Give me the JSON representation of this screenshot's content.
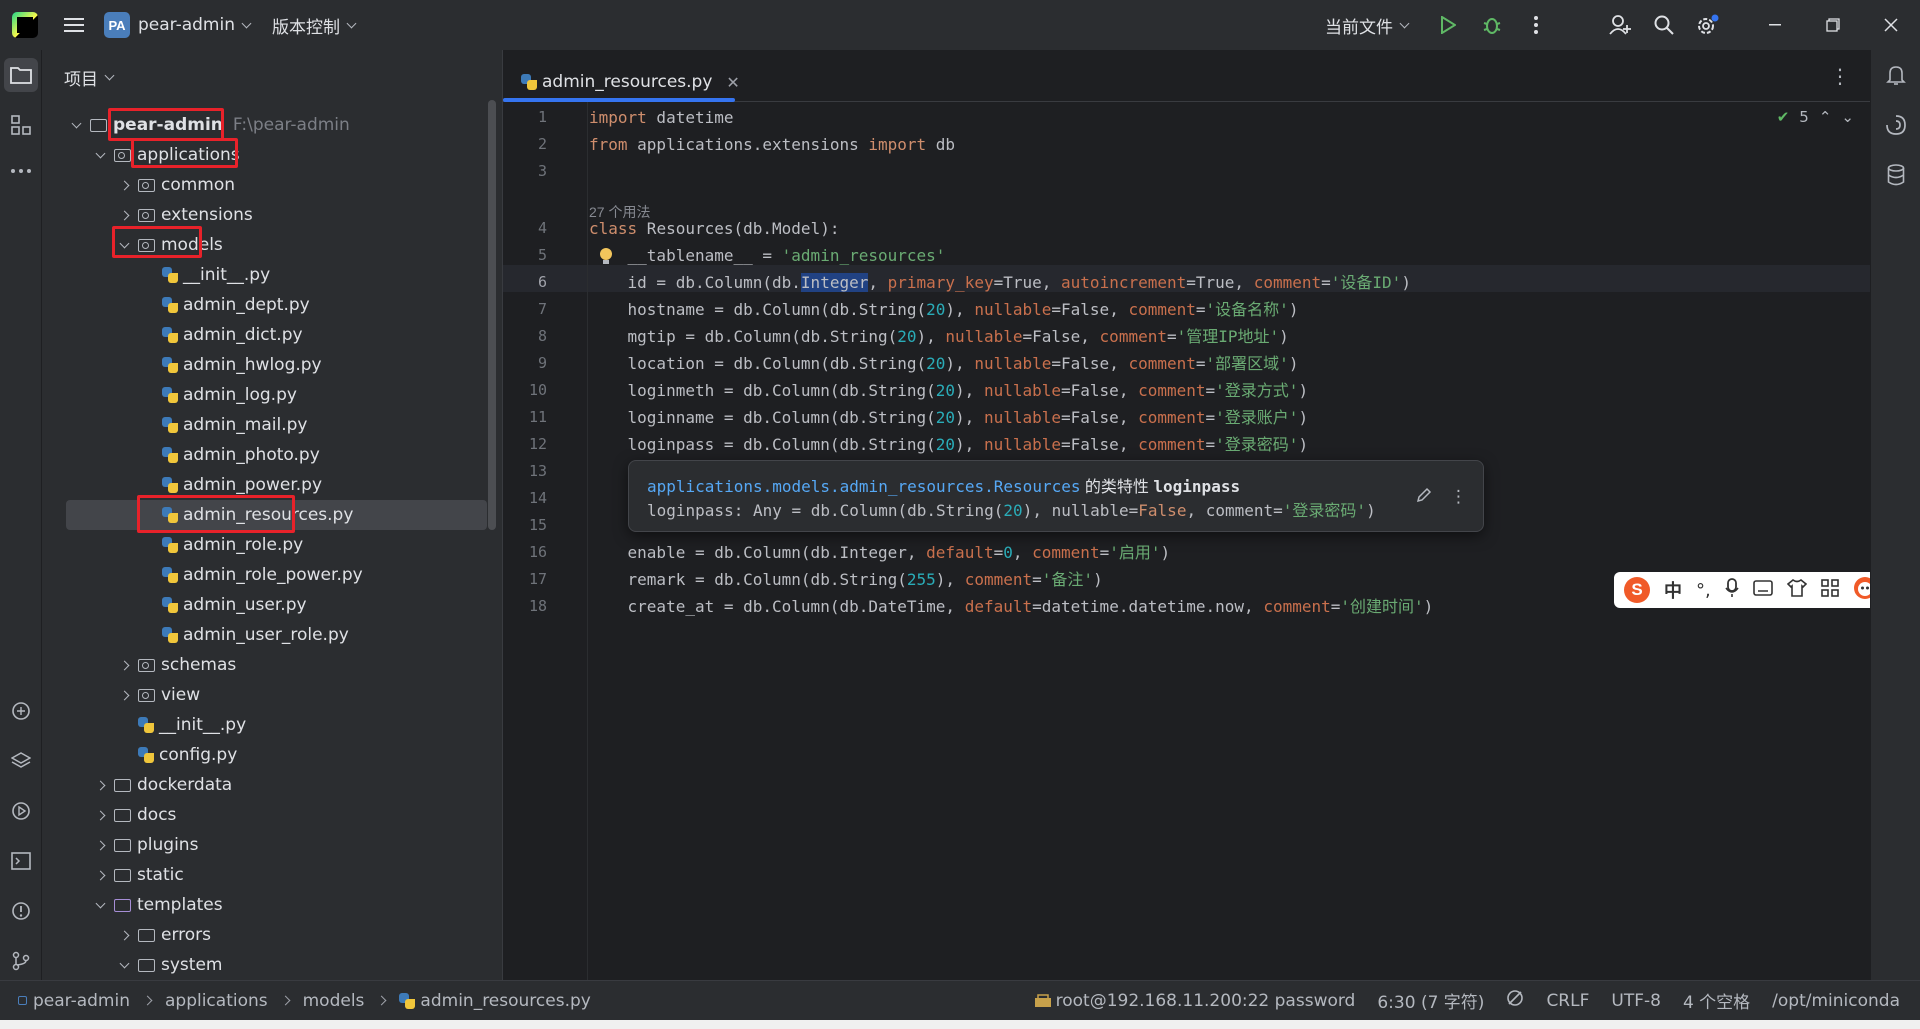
{
  "titlebar": {
    "project_badge": "PA",
    "project_name": "pear-admin",
    "vcs": "版本控制",
    "run_config": "当前文件"
  },
  "project_panel": {
    "title": "项目",
    "root_label": "pear-admin",
    "root_path": "F:\\pear-admin",
    "items": [
      {
        "label": "applications"
      },
      {
        "label": "common"
      },
      {
        "label": "extensions"
      },
      {
        "label": "models"
      },
      {
        "label": "__init__.py"
      },
      {
        "label": "admin_dept.py"
      },
      {
        "label": "admin_dict.py"
      },
      {
        "label": "admin_hwlog.py"
      },
      {
        "label": "admin_log.py"
      },
      {
        "label": "admin_mail.py"
      },
      {
        "label": "admin_photo.py"
      },
      {
        "label": "admin_power.py"
      },
      {
        "label": "admin_resources.py"
      },
      {
        "label": "admin_role.py"
      },
      {
        "label": "admin_role_power.py"
      },
      {
        "label": "admin_user.py"
      },
      {
        "label": "admin_user_role.py"
      },
      {
        "label": "schemas"
      },
      {
        "label": "view"
      },
      {
        "label": "__init__.py"
      },
      {
        "label": "config.py"
      },
      {
        "label": "dockerdata"
      },
      {
        "label": "docs"
      },
      {
        "label": "plugins"
      },
      {
        "label": "static"
      },
      {
        "label": "templates"
      },
      {
        "label": "errors"
      },
      {
        "label": "system"
      }
    ]
  },
  "editor": {
    "tab_label": "admin_resources.py",
    "inspection_count": "5",
    "usages_hint": "27 个用法",
    "line_numbers": [
      "1",
      "2",
      "3",
      "4",
      "5",
      "6",
      "7",
      "8",
      "9",
      "10",
      "11",
      "12",
      "13",
      "14",
      "15",
      "16",
      "17",
      "18"
    ],
    "code": {
      "l1_kw": "import",
      "l1_rest": " datetime",
      "l2_kw1": "from",
      "l2_mod": " applications.extensions ",
      "l2_kw2": "import",
      "l2_rest": " db",
      "l4_kw": "class",
      "l4_rest": " Resources(db.Model):",
      "l5_a": "    __tablename__ = ",
      "l5_s": "'admin_resources'",
      "l6_a": "    id = db.Column(db.",
      "l6_sel": "Integer",
      "l6_b": ", ",
      "l6_p1": "primary_key",
      "l6_c": "=True, ",
      "l6_p2": "autoincrement",
      "l6_d": "=True, ",
      "l6_p3": "comment",
      "l6_e": "=",
      "l6_s": "'设备ID'",
      "l6_f": ")",
      "l7_a": "    hostname = db.Column(db.String(",
      "l7_n": "20",
      "l7_b": "), ",
      "l7_p1": "nullable",
      "l7_c": "=False, ",
      "l7_p2": "comment",
      "l7_d": "=",
      "l7_s": "'设备名称'",
      "l7_e": ")",
      "l8_a": "    mgtip = db.Column(db.String(",
      "l8_n": "20",
      "l8_b": "), ",
      "l8_p1": "nullable",
      "l8_c": "=False, ",
      "l8_p2": "comment",
      "l8_d": "=",
      "l8_s": "'管理IP地址'",
      "l8_e": ")",
      "l9_a": "    location = db.Column(db.String(",
      "l9_n": "20",
      "l9_b": "), ",
      "l9_p1": "nullable",
      "l9_c": "=False, ",
      "l9_p2": "comment",
      "l9_d": "=",
      "l9_s": "'部署区域'",
      "l9_e": ")",
      "l10_a": "    loginmeth = db.Column(db.String(",
      "l10_n": "20",
      "l10_b": "), ",
      "l10_p1": "nullable",
      "l10_c": "=False, ",
      "l10_p2": "comment",
      "l10_d": "=",
      "l10_s": "'登录方式'",
      "l10_e": ")",
      "l11_a": "    loginname = db.Column(db.String(",
      "l11_n": "20",
      "l11_b": "), ",
      "l11_p1": "nullable",
      "l11_c": "=False, ",
      "l11_p2": "comment",
      "l11_d": "=",
      "l11_s": "'登录账户'",
      "l11_e": ")",
      "l12_a": "    loginpass = db.Column(db.String(",
      "l12_n": "20",
      "l12_b": "), ",
      "l12_p1": "nullable",
      "l12_c": "=False, ",
      "l12_p2": "comment",
      "l12_d": "=",
      "l12_s": "'登录密码'",
      "l12_e": ")",
      "l16_a": "    enable = db.Column(db.Integer, ",
      "l16_p1": "default",
      "l16_b": "=",
      "l16_n": "0",
      "l16_c": ", ",
      "l16_p2": "comment",
      "l16_d": "=",
      "l16_s": "'启用'",
      "l16_e": ")",
      "l17_a": "    remark = db.Column(db.String(",
      "l17_n": "255",
      "l17_b": "), ",
      "l17_p": "comment",
      "l17_c": "=",
      "l17_s": "'备注'",
      "l17_d": ")",
      "l18_a": "    create_at = db.Column(db.DateTime, ",
      "l18_p1": "default",
      "l18_b": "=datetime.datetime.now, ",
      "l18_p2": "comment",
      "l18_c": "=",
      "l18_s": "'创建时间'",
      "l18_d": ")"
    }
  },
  "popup": {
    "qualified": "applications.models.admin_resources.Resources",
    "kind": " 的类特性 ",
    "name": "loginpass",
    "sig_a": "loginpass: Any = db.Column(db.String(",
    "sig_n": "20",
    "sig_b": "), nullable=",
    "sig_kw": "False",
    "sig_c": ", comment=",
    "sig_s": "'登录密码'",
    "sig_d": ")"
  },
  "ime": {
    "logo": "S",
    "mode": "中"
  },
  "statusbar": {
    "crumbs": [
      "pear-admin",
      "applications",
      "models",
      "admin_resources.py"
    ],
    "interpreter": "root@192.168.11.200:22 password",
    "position": "6:30 (7 字符)",
    "line_sep": "CRLF",
    "encoding": "UTF-8",
    "indent": "4 个空格",
    "sdk": "/opt/miniconda"
  },
  "colors": {
    "accent": "#3574f0",
    "highlight_box": "#e8222a",
    "keyword": "#cf8e6d",
    "string": "#6aab73",
    "number": "#2aacb8"
  }
}
